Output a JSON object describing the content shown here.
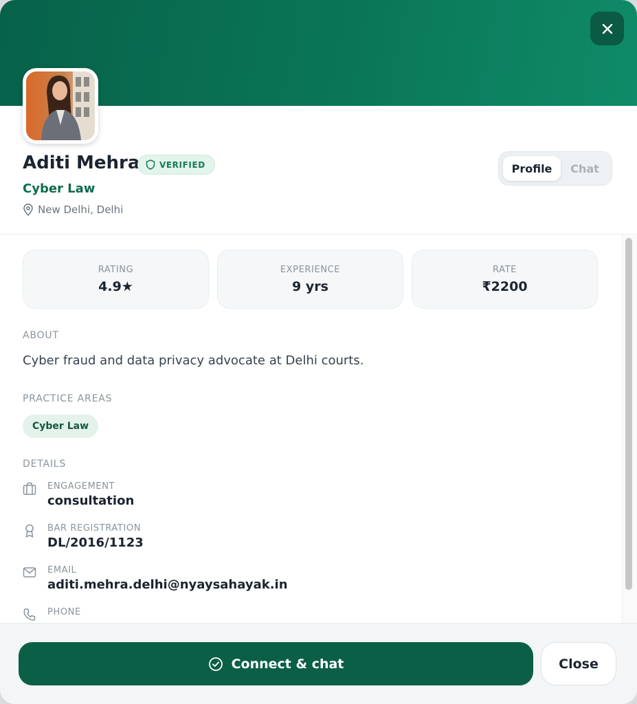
{
  "colors": {
    "brand": "#0b5f46",
    "accent": "#0d6b4e",
    "verified": "#177a55"
  },
  "profile": {
    "name": "Aditi Mehra",
    "verified_label": "VERIFIED",
    "specialty": "Cyber Law",
    "location": "New Delhi, Delhi"
  },
  "tabs": [
    {
      "label": "Profile",
      "active": true
    },
    {
      "label": "Chat",
      "active": false
    }
  ],
  "stats": [
    {
      "label": "RATING",
      "value": "4.9★"
    },
    {
      "label": "EXPERIENCE",
      "value": "9 yrs"
    },
    {
      "label": "RATE",
      "value": "₹2200"
    }
  ],
  "about": {
    "heading": "ABOUT",
    "text": "Cyber fraud and data privacy advocate at Delhi courts."
  },
  "practice_areas": {
    "heading": "PRACTICE AREAS",
    "items": [
      "Cyber Law"
    ]
  },
  "details": {
    "heading": "DETAILS",
    "items": [
      {
        "icon": "briefcase-icon",
        "label": "ENGAGEMENT",
        "value": "consultation"
      },
      {
        "icon": "award-icon",
        "label": "BAR REGISTRATION",
        "value": "DL/2016/1123"
      },
      {
        "icon": "mail-icon",
        "label": "EMAIL",
        "value": "aditi.mehra.delhi@nyaysahayak.in"
      },
      {
        "icon": "phone-icon",
        "label": "PHONE",
        "value": ""
      }
    ]
  },
  "footer": {
    "connect_label": "Connect & chat",
    "close_label": "Close"
  }
}
